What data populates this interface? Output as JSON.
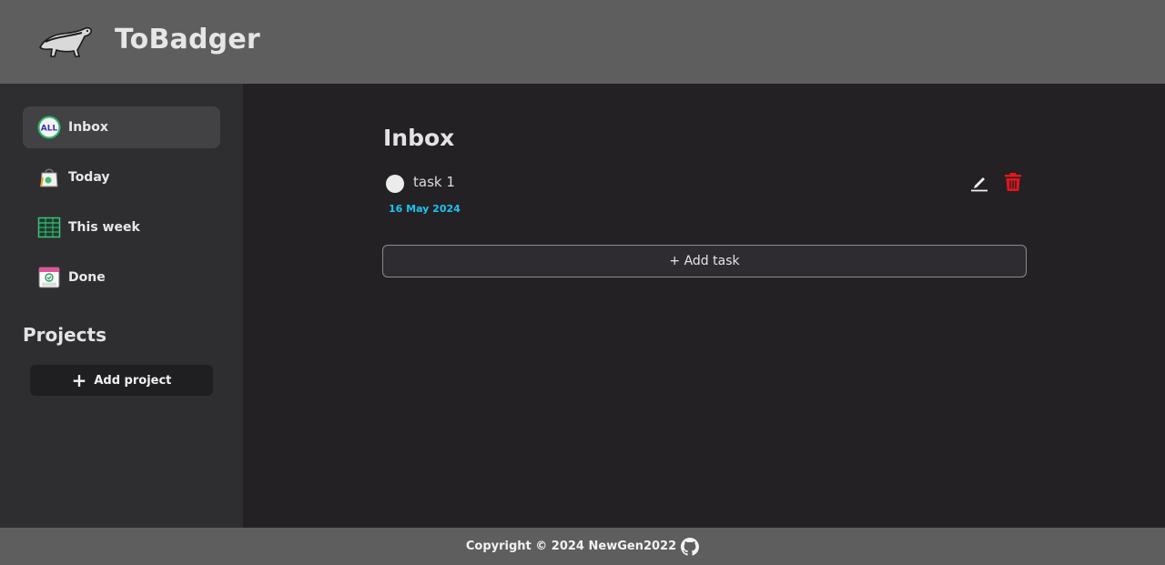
{
  "app": {
    "title": "ToBadger"
  },
  "sidebar": {
    "items": [
      {
        "label": "Inbox",
        "icon": "all-icon",
        "active": true
      },
      {
        "label": "Today",
        "icon": "shopping-bag-icon",
        "active": false
      },
      {
        "label": "This week",
        "icon": "calendar-grid-icon",
        "active": false
      },
      {
        "label": "Done",
        "icon": "done-calendar-icon",
        "active": false
      }
    ],
    "projects_title": "Projects",
    "add_project_plus": "+",
    "add_project_label": "Add project"
  },
  "main": {
    "title": "Inbox",
    "tasks": [
      {
        "name": "task 1",
        "date": "16 May 2024"
      }
    ],
    "add_task_label": "+ Add task"
  },
  "footer": {
    "text": "Copyright © 2024 NewGen2022"
  },
  "colors": {
    "header": "#5e5e5e",
    "sidebar": "#2e2d30",
    "main": "#232124",
    "active_item": "#424244",
    "date": "#1ec3f0",
    "delete": "#e3161c"
  }
}
